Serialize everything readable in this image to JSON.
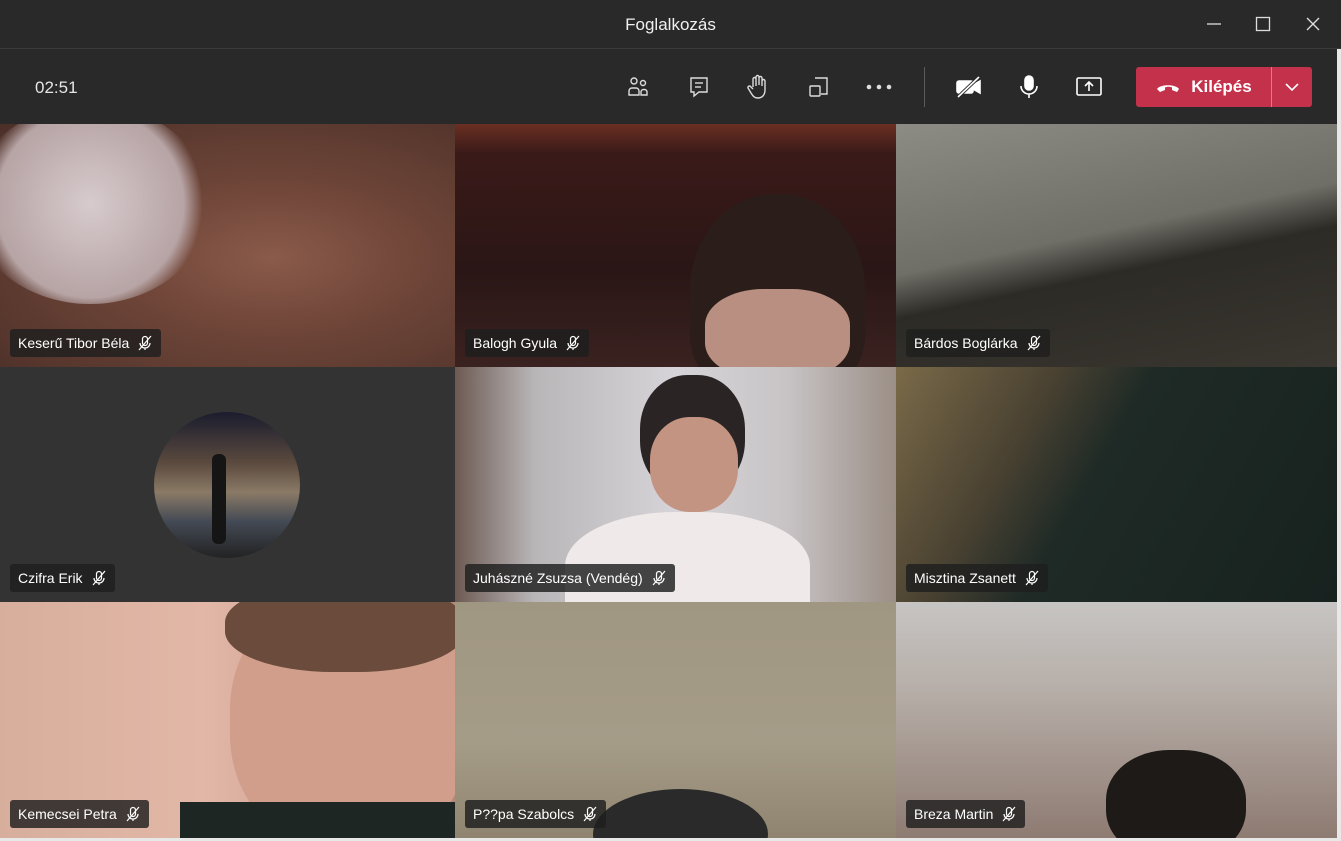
{
  "window": {
    "title": "Foglalkozás"
  },
  "toolbar": {
    "timer": "02:51",
    "leave_label": "Kilépés"
  },
  "icons": [
    "people-icon",
    "chat-icon",
    "raise-hand-icon",
    "room-view-icon",
    "more-icon",
    "camera-off-icon",
    "microphone-icon",
    "share-screen-icon",
    "phone-hangup-icon",
    "chevron-down-icon",
    "mic-muted-icon"
  ],
  "colors": {
    "leave_button": "#c4314b",
    "toolbar_bg": "#292929"
  },
  "participants": [
    {
      "name": "Keserű Tibor Béla"
    },
    {
      "name": "Balogh Gyula"
    },
    {
      "name": "Bárdos Boglárka"
    },
    {
      "name": "Czifra Erik"
    },
    {
      "name": "Juhászné Zsuzsa (Vendég)"
    },
    {
      "name": "Misztina Zsanett"
    },
    {
      "name": "Kemecsei Petra"
    },
    {
      "name": "P??pa Szabolcs"
    },
    {
      "name": "Breza Martin"
    }
  ]
}
